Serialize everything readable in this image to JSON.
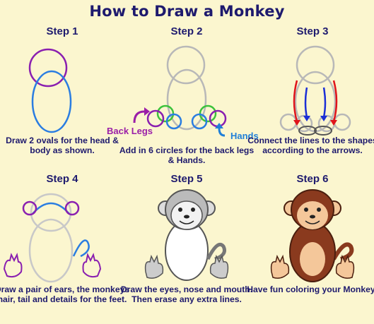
{
  "title": "How to Draw a Monkey",
  "steps": [
    {
      "label": "Step 1",
      "caption": "Draw 2 ovals for the head & body as shown."
    },
    {
      "label": "Step 2",
      "caption": "Add in 6 circles for the back legs & Hands.",
      "annotations": {
        "back_legs": "Back Legs",
        "hands": "Hands"
      }
    },
    {
      "label": "Step 3",
      "caption": "Connect the lines to the shapes according to the arrows."
    },
    {
      "label": "Step 4",
      "caption": "Draw a pair of ears, the monkeys hair, tail and details for the feet."
    },
    {
      "label": "Step 5",
      "caption": "Draw the eyes, nose and mouth. Then erase any extra lines."
    },
    {
      "label": "Step 6",
      "caption": "Have fun coloring your Monkey!"
    }
  ],
  "colors": {
    "background": "#fbf6cf",
    "text": "#1e1a6e",
    "guide_purple": "#8a1fb0",
    "guide_blue": "#2a7de1",
    "guide_green": "#3cc23c",
    "arrow_red": "#e0141b",
    "arrow_blue": "#1c2fd6",
    "annotation_purple": "#9a1ea8",
    "annotation_blue": "#1f7fd8",
    "monkey_brown": "#8a3a1e",
    "monkey_face": "#f4c79a"
  }
}
